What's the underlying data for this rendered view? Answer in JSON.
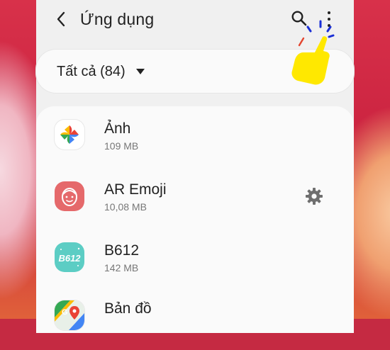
{
  "header": {
    "title": "Ứng dụng",
    "back_icon": "chevron-left-icon",
    "search_icon": "search-icon",
    "more_icon": "more-vertical-icon"
  },
  "filter": {
    "label": "Tất cả (84)",
    "dropdown_icon": "triangle-down-icon"
  },
  "apps": [
    {
      "name": "Ảnh",
      "size": "109 MB",
      "icon": "google-photos-icon"
    },
    {
      "name": "AR Emoji",
      "size": "10,08 MB",
      "icon": "ar-emoji-icon",
      "action_icon": "gear-icon"
    },
    {
      "name": "B612",
      "size": "142 MB",
      "icon": "b612-icon"
    },
    {
      "name": "Bản đồ",
      "size": "",
      "icon": "google-maps-icon"
    }
  ],
  "colors": {
    "ar_emoji": "#e5696b",
    "b612": "#5ccdc4",
    "pointer_hand": "#ffe800"
  }
}
